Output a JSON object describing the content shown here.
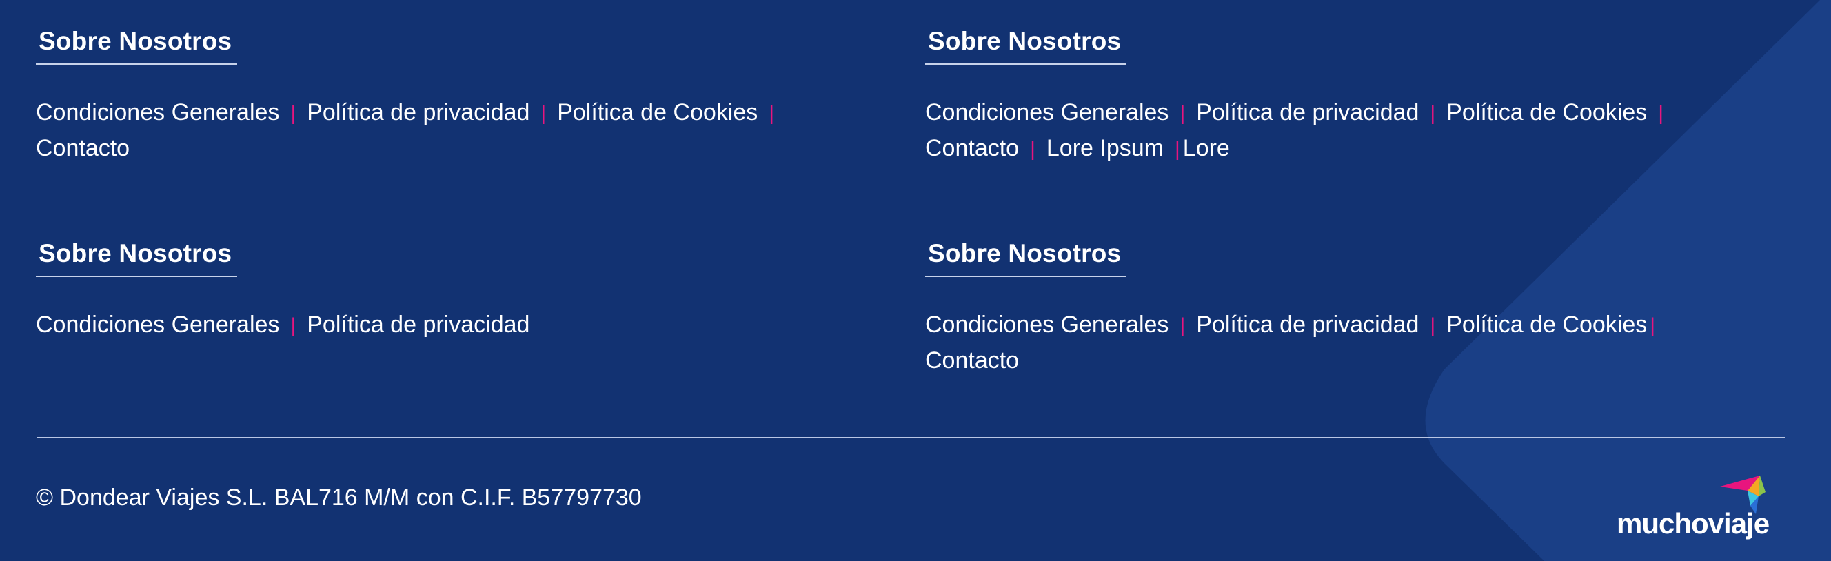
{
  "sections": [
    {
      "heading": "Sobre Nosotros",
      "links": [
        "Condiciones Generales",
        "Política de privacidad",
        "Política de Cookies",
        "Contacto"
      ]
    },
    {
      "heading": "Sobre Nosotros",
      "links": [
        "Condiciones Generales",
        "Política de privacidad",
        "Política de Cookies",
        "Contacto",
        "Lore Ipsum",
        "Lore"
      ]
    },
    {
      "heading": "Sobre Nosotros",
      "links": [
        "Condiciones Generales",
        "Política de privacidad"
      ]
    },
    {
      "heading": "Sobre Nosotros",
      "links": [
        "Condiciones Generales",
        "Política de privacidad",
        "Política de Cookies",
        "Contacto"
      ]
    }
  ],
  "separator": "|",
  "copyright": "© Dondear Viajes S.L. BAL716 M/M con C.I.F. B57797730",
  "logo": {
    "text": "muchoviaje",
    "icon": "paper-plane-logo-icon"
  },
  "colors": {
    "background": "#123272",
    "background_shape": "#1a3f86",
    "separator": "#e8157e",
    "text": "#ffffff"
  }
}
